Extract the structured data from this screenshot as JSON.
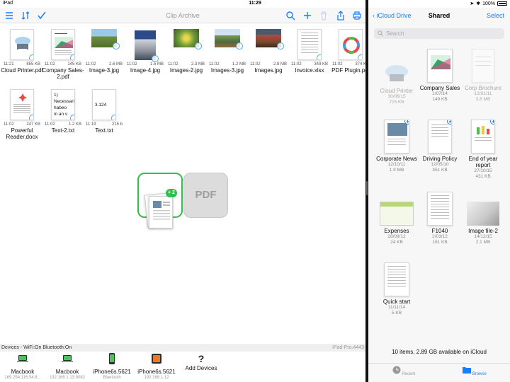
{
  "status": {
    "device": "iPad",
    "time": "11:29",
    "battery": "100%"
  },
  "toolbar": {
    "title": "Clip Archive"
  },
  "files": [
    {
      "time": "11:21",
      "size": "855 KB",
      "name": "Cloud Printer.pdf"
    },
    {
      "time": "11:02",
      "size": "145 KB",
      "name": "Company Sales-2.pdf"
    },
    {
      "time": "11:02",
      "size": "2.6 MB",
      "name": "Image-3.jpg"
    },
    {
      "time": "11:02",
      "size": "1.5 MB",
      "name": "Image-4.jpg"
    },
    {
      "time": "11:02",
      "size": "2.3 MB",
      "name": "Images-2.jpg"
    },
    {
      "time": "11:02",
      "size": "1.2 MB",
      "name": "Images-3.jpg"
    },
    {
      "time": "11:02",
      "size": "2.8 MB",
      "name": "Images.jpg"
    },
    {
      "time": "11:02",
      "size": "349 KB",
      "name": "Invoice.xlsx"
    },
    {
      "time": "11:02",
      "size": "374 KB",
      "name": "PDF Plugin.pdf"
    },
    {
      "time": "11:02",
      "size": "247 KB",
      "name": "Powerful Reader.docx"
    },
    {
      "time": "11:02",
      "size": "1.2 KB",
      "name": "Text-2.txt",
      "preview": [
        "1)",
        "Necessari",
        "habeo",
        "in an v"
      ]
    },
    {
      "time": "11:19",
      "size": "215 b",
      "name": "Text.txt",
      "preview": [
        "3.124"
      ]
    }
  ],
  "drag": {
    "count": "2",
    "pdf_label": "PDF"
  },
  "devices_bar": {
    "status": "Devices - WiFi:On  Bluetooth:On",
    "host": "iPad-Pro.4443"
  },
  "devices": [
    {
      "name": "Macbook",
      "sub": "169.254.116.54:8..."
    },
    {
      "name": "Macbook",
      "sub": "192.168.1.13:8082"
    },
    {
      "name": "iPhone6s.5621",
      "sub": "Bluetooth"
    },
    {
      "name": "iPhone6s.5621",
      "sub": "192.168.1.12"
    },
    {
      "name": "Add Devices",
      "sub": ""
    }
  ],
  "icloud": {
    "back": "iCloud Drive",
    "title": "Shared",
    "select": "Select",
    "search_placeholder": "Search",
    "items": [
      {
        "name": "Cloud Printer",
        "date": "30/06/15",
        "size": "715 KB",
        "dim": true
      },
      {
        "name": "Company Sales",
        "date": "1/07/14",
        "size": "149 KB",
        "dim": false
      },
      {
        "name": "Corp Brochure",
        "date": "12/01/11",
        "size": "3.8 MB",
        "dim": true
      },
      {
        "name": "Corporate News",
        "date": "12/10/11",
        "size": "1.9 MB",
        "dim": false
      },
      {
        "name": "Driving Policy",
        "date": "12/05/10",
        "size": "451 KB",
        "dim": false
      },
      {
        "name": "End of year report",
        "date": "27/10/15",
        "size": "431 KB",
        "dim": false
      },
      {
        "name": "Expenses",
        "date": "28/09/12",
        "size": "24 KB",
        "dim": false
      },
      {
        "name": "F1040",
        "date": "2/03/12",
        "size": "161 KB",
        "dim": false
      },
      {
        "name": "Image file-2",
        "date": "14/12/15",
        "size": "2.1 MB",
        "dim": false
      },
      {
        "name": "Quick start",
        "date": "11/11/14",
        "size": "5 KB",
        "dim": false
      }
    ],
    "footer": "10 items, 2.89 GB available on iCloud",
    "tabs": {
      "recent": "Recent",
      "browse": "Browse"
    }
  }
}
